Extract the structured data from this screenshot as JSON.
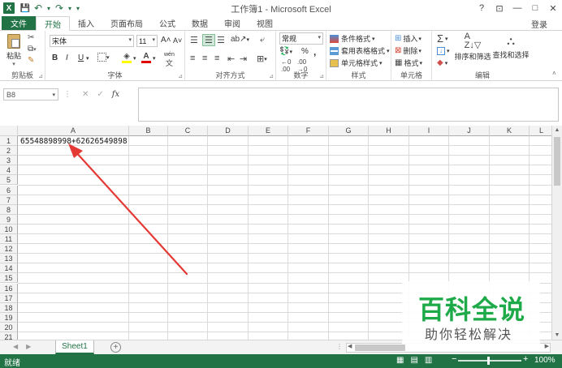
{
  "window": {
    "title": "工作簿1 - Microsoft Excel",
    "help": "?",
    "ribbon_options": "⊡",
    "minimize": "—",
    "restore": "□",
    "close": "✕"
  },
  "quick_access": {
    "logo": "X",
    "save": "💾",
    "undo": "↶",
    "redo": "↷",
    "more": "▾"
  },
  "tabs": [
    "开始",
    "插入",
    "页面布局",
    "公式",
    "数据",
    "审阅",
    "视图"
  ],
  "file_tab": "文件",
  "login": "登录",
  "ribbon": {
    "clipboard": {
      "label": "剪贴板",
      "paste": "粘贴"
    },
    "font": {
      "label": "字体",
      "font_name": "宋体",
      "font_size": "11",
      "bold": "B",
      "italic": "I",
      "underline": "U",
      "grow": "A˄",
      "shrink": "A˅",
      "wen": "wén"
    },
    "alignment": {
      "label": "对齐方式"
    },
    "number": {
      "label": "数字",
      "format": "常规",
      "percent": "%",
      "comma": ","
    },
    "styles": {
      "label": "样式",
      "conditional": "条件格式",
      "table": "套用表格格式",
      "cell_styles": "单元格样式"
    },
    "cells": {
      "label": "单元格",
      "insert": "插入",
      "delete": "删除",
      "format": "格式"
    },
    "editing": {
      "label": "编辑",
      "sort_filter": "排序和筛选",
      "find_select": "查找和选择",
      "sum": "Σ"
    }
  },
  "formula_bar": {
    "name_box": "B8",
    "cancel": "✕",
    "enter": "✓",
    "fx": "fx",
    "value": ""
  },
  "columns": [
    "A",
    "B",
    "C",
    "D",
    "E",
    "F",
    "G",
    "H",
    "I",
    "J",
    "K",
    "L"
  ],
  "rows": [
    "1",
    "2",
    "3",
    "4",
    "5",
    "6",
    "7",
    "8",
    "9",
    "10",
    "11",
    "12",
    "13",
    "14",
    "15",
    "16",
    "17",
    "18",
    "19",
    "20",
    "21"
  ],
  "cells": {
    "A1": "65548898998+62626549898"
  },
  "sheets": [
    "Sheet1"
  ],
  "status": {
    "ready": "就绪",
    "zoom": "100%",
    "minus": "−",
    "plus": "+"
  },
  "watermark": {
    "title": "百科全说",
    "subtitle": "助你轻松解决"
  },
  "colors": {
    "accent": "#217346",
    "arrow": "#e53935",
    "watermark": "#1faa4a"
  }
}
